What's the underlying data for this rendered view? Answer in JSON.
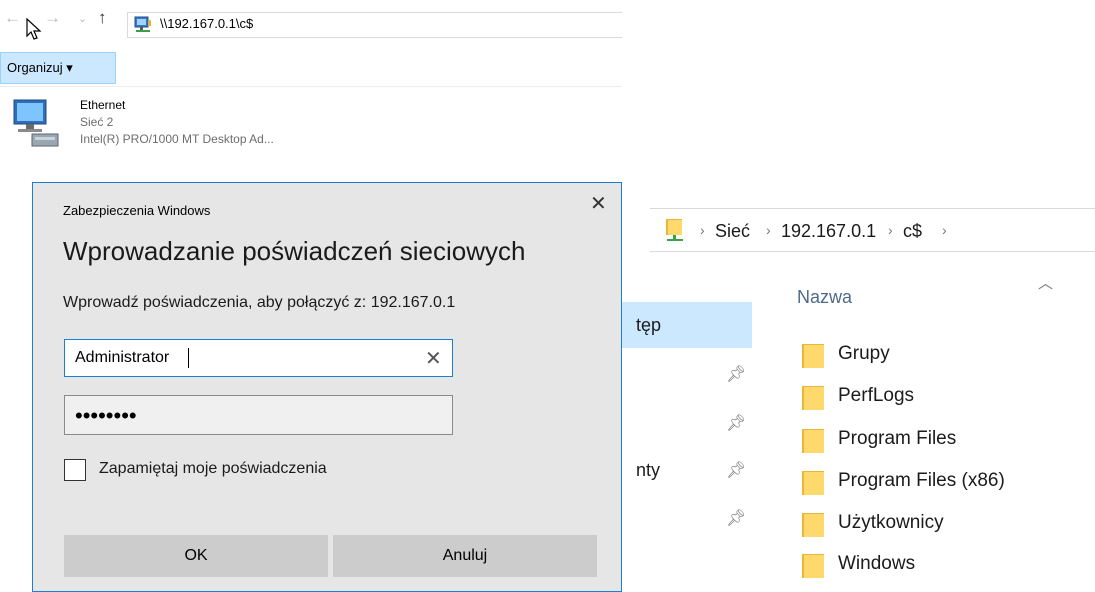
{
  "explorer_left": {
    "address_path": "\\\\192.167.0.1\\c$",
    "toolbar": {
      "organize_label": "Organizuj ▾"
    },
    "network_item": {
      "name": "Ethernet",
      "network": "Sieć 2",
      "adapter": "Intel(R) PRO/1000 MT Desktop Ad..."
    }
  },
  "dialog": {
    "caption": "Zabezpieczenia Windows",
    "close_glyph": "✕",
    "heading": "Wprowadzanie poświadczeń sieciowych",
    "subtitle": "Wprowadź poświadczenia, aby połączyć z: 192.167.0.1",
    "username_value": "Administrator",
    "clear_glyph": "✕",
    "password_value": "••••••••",
    "remember_label": "Zapamiętaj moje poświadczenia",
    "remember_checked": false,
    "ok_label": "OK",
    "cancel_label": "Anuluj"
  },
  "explorer_right": {
    "breadcrumb": [
      "Sieć",
      "192.167.0.1",
      "c$"
    ],
    "nav_fragments": [
      "tęp",
      "nty"
    ],
    "column_header": "Nazwa",
    "folders": [
      "Grupy",
      "PerfLogs",
      "Program Files",
      "Program Files (x86)",
      "Użytkownicy",
      "Windows"
    ]
  },
  "colors": {
    "accent": "#1c7ed6",
    "selection": "#cce8ff",
    "folder": "#ffd96b",
    "dialog_bg": "#e6e6e6"
  }
}
